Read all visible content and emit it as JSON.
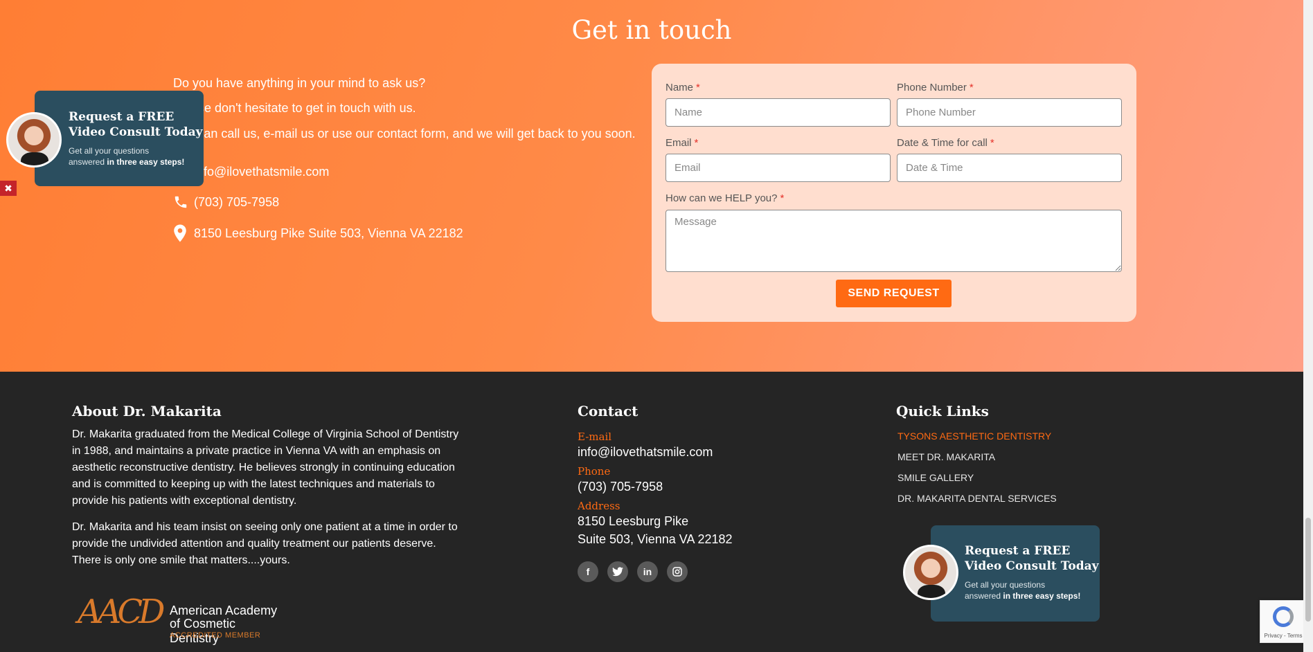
{
  "get_in_touch": {
    "title": "Get in touch",
    "intro": [
      "Do you have anything in your mind to ask us?",
      "Please don't hesitate to get in touch with us.",
      "You can call us, e-mail us or use our contact form, and we will get back to you soon."
    ],
    "email": "info@ilovethatsmile.com",
    "phone": "(703) 705-7958",
    "address": "8150 Leesburg Pike Suite 503, Vienna VA 22182"
  },
  "form": {
    "name_label": "Name",
    "name_placeholder": "Name",
    "phone_label": "Phone Number",
    "phone_placeholder": "Phone Number",
    "email_label": "Email",
    "email_placeholder": "Email",
    "datetime_label": "Date & Time for call",
    "datetime_placeholder": "Date & Time",
    "message_label": "How can we HELP you?",
    "message_placeholder": "Message",
    "required_mark": "*",
    "submit_label": "SEND REQUEST"
  },
  "promo": {
    "title_line1": "Request a FREE",
    "title_line2": "Video Consult Today",
    "sub_line1": "Get all your questions",
    "sub_line2_plain": "answered",
    "sub_line2_bold": "in three easy steps!",
    "close_symbol": "✖"
  },
  "footer": {
    "about": {
      "heading": "About Dr. Makarita",
      "p1": "Dr. Makarita graduated from the Medical College of Virginia School of Dentistry in 1988, and maintains a private practice in Vienna VA with an emphasis on aesthetic reconstructive dentistry. He believes strongly in continuing education and is committed to keeping up with the latest techniques and materials to provide his patients with exceptional dentistry.",
      "p2": "Dr. Makarita and his team insist on seeing only one patient at a time in order to provide the undivided attention and quality treatment our patients deserve. There is only one smile that matters....yours."
    },
    "contact": {
      "heading": "Contact",
      "email_label": "E-mail",
      "email": "info@ilovethatsmile.com",
      "phone_label": "Phone",
      "phone": "(703) 705-7958",
      "address_label": "Address",
      "address_line1": "8150 Leesburg Pike",
      "address_line2": "Suite 503, Vienna VA 22182"
    },
    "quick_links": {
      "heading": "Quick Links",
      "items": [
        "TYSONS AESTHETIC DENTISTRY",
        "MEET DR. MAKARITA",
        "SMILE GALLERY",
        "DR. MAKARITA DENTAL SERVICES"
      ]
    },
    "aacd": {
      "mark": "AACD",
      "line1": "American Academy",
      "line2": "of Cosmetic Dentistry",
      "line3": "ACCREDITED MEMBER"
    }
  },
  "recaptcha": {
    "links": "Privacy - Terms"
  },
  "colors": {
    "accent": "#ff6a13",
    "promo_bg": "#2b4e5f",
    "footer_bg": "#252525"
  },
  "icons": [
    "phone-icon",
    "location-pin-icon",
    "facebook-icon",
    "twitter-icon",
    "linkedin-icon",
    "instagram-icon",
    "close-icon",
    "recaptcha-icon"
  ]
}
